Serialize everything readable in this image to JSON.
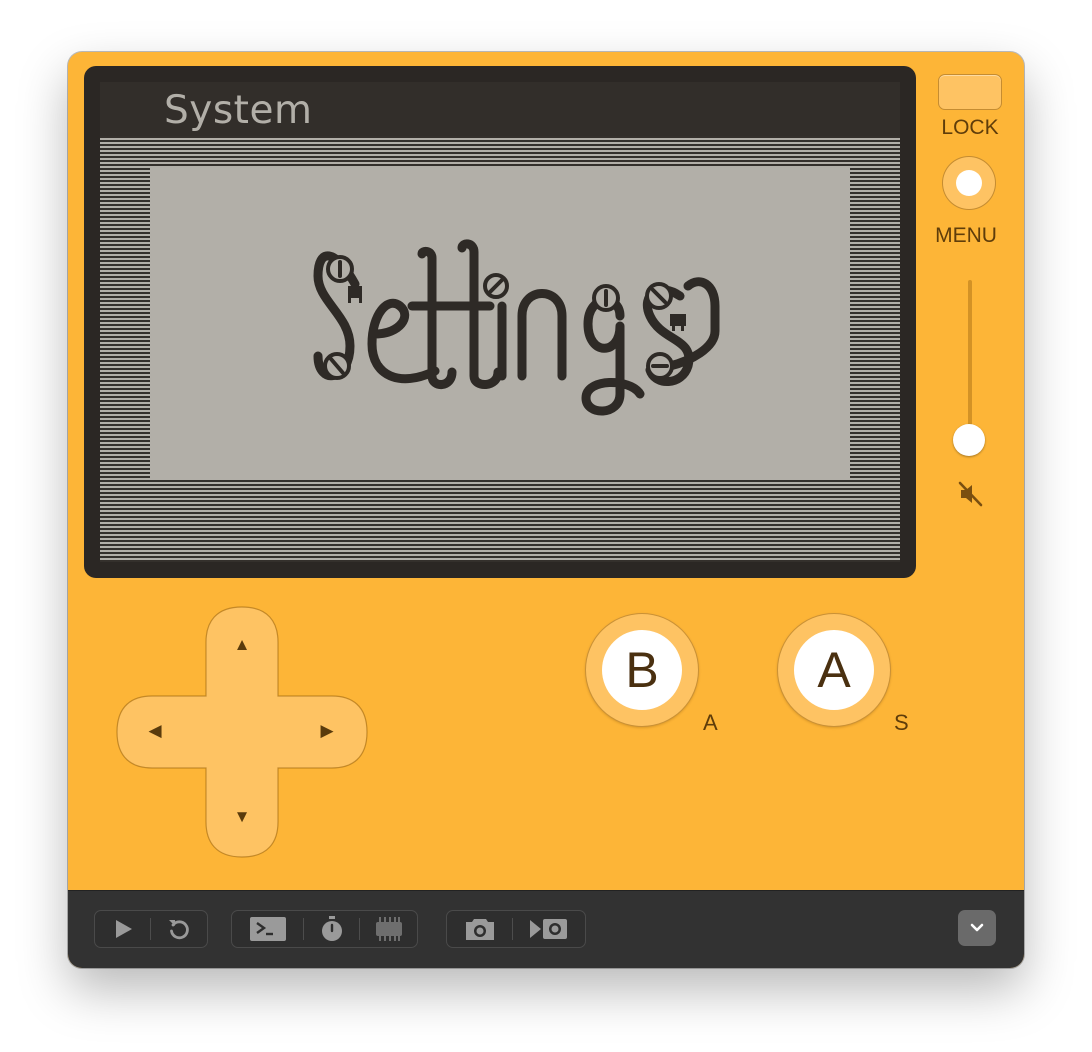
{
  "screen": {
    "title": "System",
    "card_art_text": "Settings"
  },
  "side_controls": {
    "lock_label": "LOCK",
    "menu_label": "MENU",
    "volume_level": 0.0,
    "mute_icon": "speaker-muted-icon"
  },
  "dpad": {
    "up_glyph": "▲",
    "down_glyph": "▼",
    "left_glyph": "◀",
    "right_glyph": "▶"
  },
  "face_buttons": {
    "b_label": "B",
    "b_key": "A",
    "a_label": "A",
    "a_key": "S"
  },
  "toolbar": {
    "icons": [
      "play-icon",
      "restart-icon",
      "console-icon",
      "stopwatch-icon",
      "chip-icon",
      "camera-icon",
      "record-video-icon",
      "chevron-down-icon"
    ]
  },
  "colors": {
    "body": "#fdb537",
    "button": "#fec363",
    "screen_light": "#b2afa8",
    "screen_dark": "#322e2a",
    "toolbar": "#323232"
  }
}
